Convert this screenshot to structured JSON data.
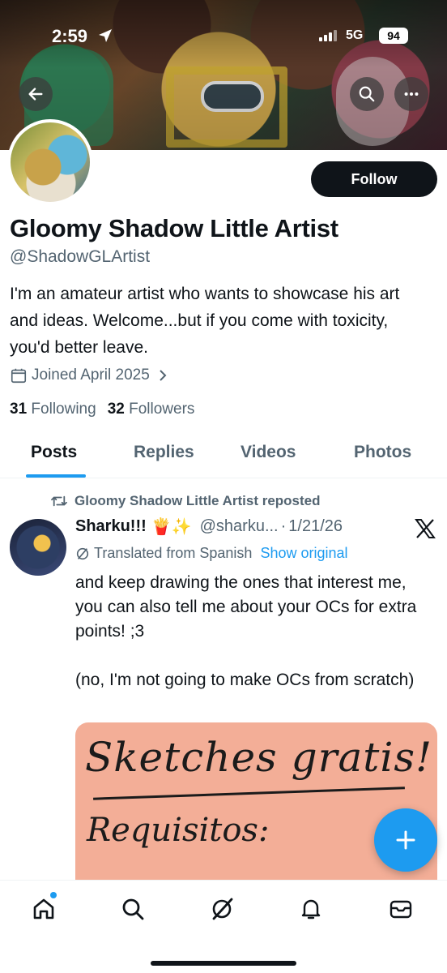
{
  "status_bar": {
    "time": "2:59",
    "network": "5G",
    "battery": "94"
  },
  "profile": {
    "display_name": "Gloomy Shadow Little Artist",
    "handle": "@ShadowGLArtist",
    "bio": "I'm an amateur artist who wants to showcase his art and ideas. Welcome...but if you come with toxicity, you'd better leave.",
    "joined": "Joined April 2025",
    "following_count": "31",
    "following_label": "Following",
    "followers_count": "32",
    "followers_label": "Followers",
    "follow_button": "Follow"
  },
  "tabs": [
    {
      "label": "Posts",
      "active": true
    },
    {
      "label": "Replies",
      "active": false
    },
    {
      "label": "Videos",
      "active": false
    },
    {
      "label": "Photos",
      "active": false
    }
  ],
  "post": {
    "repost_label": "Gloomy Shadow Little Artist reposted",
    "author_name": "Sharku!!!",
    "author_emojis": "🍟✨",
    "author_handle": "@sharku...",
    "date": "1/21/26",
    "translated_label": "Translated from Spanish",
    "show_original": "Show original",
    "text": "and keep drawing the ones that interest me, you can also tell me about your OCs for extra points! ;3\n\n(no, I'm not going to make OCs from scratch)",
    "image_title": "Sketches gratis!",
    "image_subtitle": "Requisitos:"
  },
  "colors": {
    "accent": "#1d9bf0",
    "text": "#0f1419",
    "muted": "#536471",
    "sketch_bg": "#f3ae97"
  },
  "icons": [
    "back-arrow-icon",
    "search-icon",
    "more-icon",
    "calendar-icon",
    "chevron-right-icon",
    "repost-icon",
    "x-logo-icon",
    "translate-icon",
    "plus-icon",
    "home-icon",
    "explore-icon",
    "grok-icon",
    "notifications-icon",
    "messages-icon"
  ]
}
